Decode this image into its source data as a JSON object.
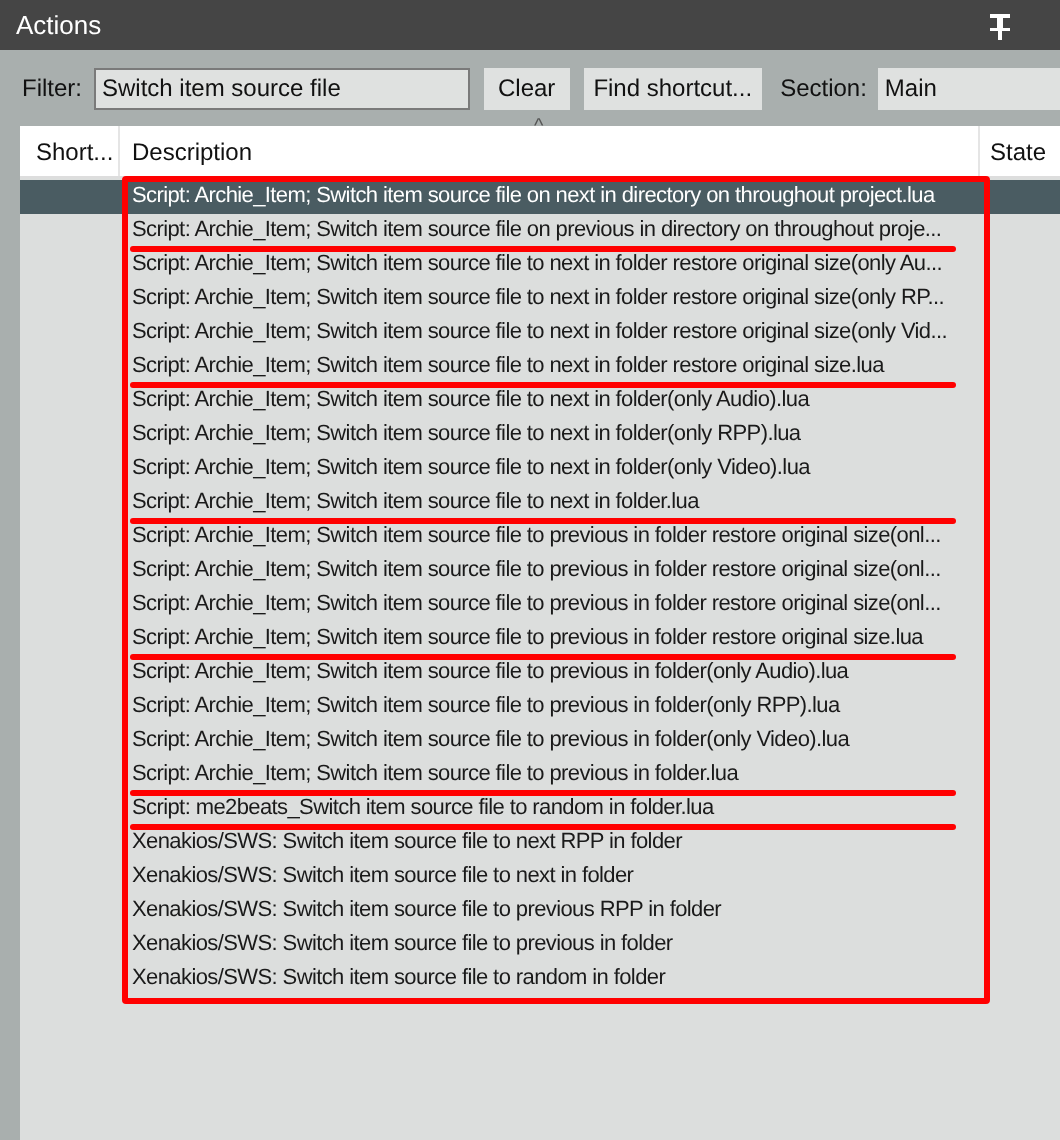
{
  "window": {
    "title": "Actions"
  },
  "filter": {
    "label": "Filter:",
    "value": "Switch item source file"
  },
  "buttons": [
    "Clear",
    "Find shortcut..."
  ],
  "section": {
    "label": "Section:",
    "value": "Main"
  },
  "table": {
    "columns": [
      "Short...",
      "Description",
      "State"
    ],
    "sort_indicator": "^",
    "rows": [
      {
        "description": "Script: Archie_Item; Switch item source file on next in directory on throughout project.lua",
        "selected": true,
        "underlined": false
      },
      {
        "description": "Script: Archie_Item; Switch item source file on previous in directory on throughout proje...",
        "selected": false,
        "underlined": true
      },
      {
        "description": "Script: Archie_Item; Switch item source file to next in folder restore original size(only Au...",
        "selected": false,
        "underlined": false
      },
      {
        "description": "Script: Archie_Item; Switch item source file to next in folder restore original size(only RP...",
        "selected": false,
        "underlined": false
      },
      {
        "description": "Script: Archie_Item; Switch item source file to next in folder restore original size(only Vid...",
        "selected": false,
        "underlined": false
      },
      {
        "description": "Script: Archie_Item; Switch item source file to next in folder restore original size.lua",
        "selected": false,
        "underlined": true
      },
      {
        "description": "Script: Archie_Item; Switch item source file to next in folder(only Audio).lua",
        "selected": false,
        "underlined": false
      },
      {
        "description": "Script: Archie_Item; Switch item source file to next in folder(only RPP).lua",
        "selected": false,
        "underlined": false
      },
      {
        "description": "Script: Archie_Item; Switch item source file to next in folder(only Video).lua",
        "selected": false,
        "underlined": false
      },
      {
        "description": "Script: Archie_Item; Switch item source file to next in folder.lua",
        "selected": false,
        "underlined": true
      },
      {
        "description": "Script: Archie_Item; Switch item source file to previous in folder restore original size(onl...",
        "selected": false,
        "underlined": false
      },
      {
        "description": "Script: Archie_Item; Switch item source file to previous in folder restore original size(onl...",
        "selected": false,
        "underlined": false
      },
      {
        "description": "Script: Archie_Item; Switch item source file to previous in folder restore original size(onl...",
        "selected": false,
        "underlined": false
      },
      {
        "description": "Script: Archie_Item; Switch item source file to previous in folder restore original size.lua",
        "selected": false,
        "underlined": true
      },
      {
        "description": "Script: Archie_Item; Switch item source file to previous in folder(only Audio).lua",
        "selected": false,
        "underlined": false
      },
      {
        "description": "Script: Archie_Item; Switch item source file to previous in folder(only RPP).lua",
        "selected": false,
        "underlined": false
      },
      {
        "description": "Script: Archie_Item; Switch item source file to previous in folder(only Video).lua",
        "selected": false,
        "underlined": false
      },
      {
        "description": "Script: Archie_Item; Switch item source file to previous in folder.lua",
        "selected": false,
        "underlined": true
      },
      {
        "description": "Script: me2beats_Switch item source file to random in folder.lua",
        "selected": false,
        "underlined": true
      },
      {
        "description": "Xenakios/SWS: Switch item source file to next RPP in folder",
        "selected": false,
        "underlined": false
      },
      {
        "description": "Xenakios/SWS: Switch item source file to next in folder",
        "selected": false,
        "underlined": false
      },
      {
        "description": "Xenakios/SWS: Switch item source file to previous RPP in folder",
        "selected": false,
        "underlined": false
      },
      {
        "description": "Xenakios/SWS: Switch item source file to previous in folder",
        "selected": false,
        "underlined": false
      },
      {
        "description": "Xenakios/SWS: Switch item source file to random in folder",
        "selected": false,
        "underlined": false
      }
    ]
  }
}
